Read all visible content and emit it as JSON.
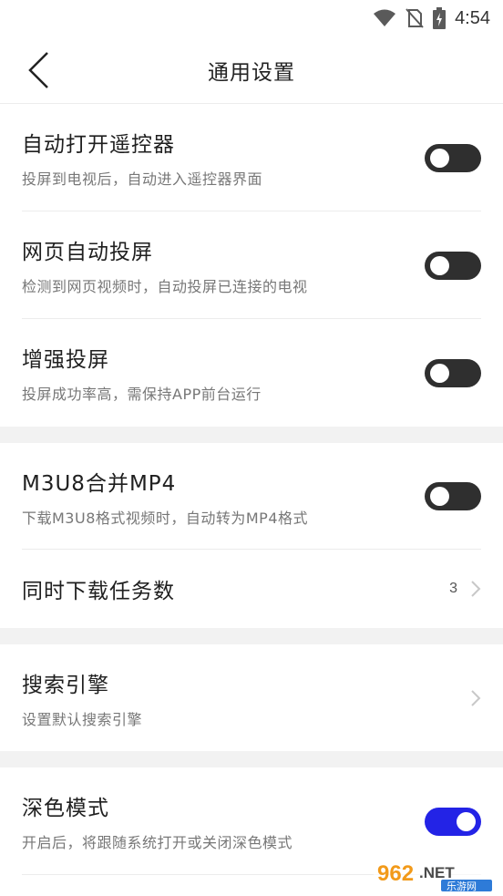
{
  "status_bar": {
    "time": "4:54",
    "icons": [
      "wifi-icon",
      "no-sim-icon",
      "battery-charging-icon"
    ]
  },
  "header": {
    "title": "通用设置",
    "back_icon": "back-arrow-icon"
  },
  "settings": {
    "remote_auto_open": {
      "title": "自动打开遥控器",
      "subtitle": "投屏到电视后，自动进入遥控器界面",
      "enabled": false
    },
    "web_auto_cast": {
      "title": "网页自动投屏",
      "subtitle": "检测到网页视频时，自动投屏已连接的电视",
      "enabled": false
    },
    "enhanced_cast": {
      "title": "增强投屏",
      "subtitle": "投屏成功率高，需保持APP前台运行",
      "enabled": false
    },
    "m3u8_merge": {
      "title": "M3U8合并MP4",
      "subtitle": "下载M3U8格式视频时，自动转为MP4格式",
      "enabled": false
    },
    "concurrent_downloads": {
      "title": "同时下载任务数",
      "value": "3"
    },
    "search_engine": {
      "title": "搜索引擎",
      "subtitle": "设置默认搜索引擎"
    },
    "dark_mode": {
      "title": "深色模式",
      "subtitle": "开启后，将跟随系统打开或关闭深色模式",
      "enabled": true
    }
  },
  "colors": {
    "toggle_off": "#2f2f2f",
    "toggle_on": "#2323e6",
    "section_gap": "#f2f2f2",
    "subtitle": "#777777"
  },
  "watermark": {
    "text_main": "962",
    "text_suffix": ".NET",
    "text_sub": "乐游网"
  }
}
